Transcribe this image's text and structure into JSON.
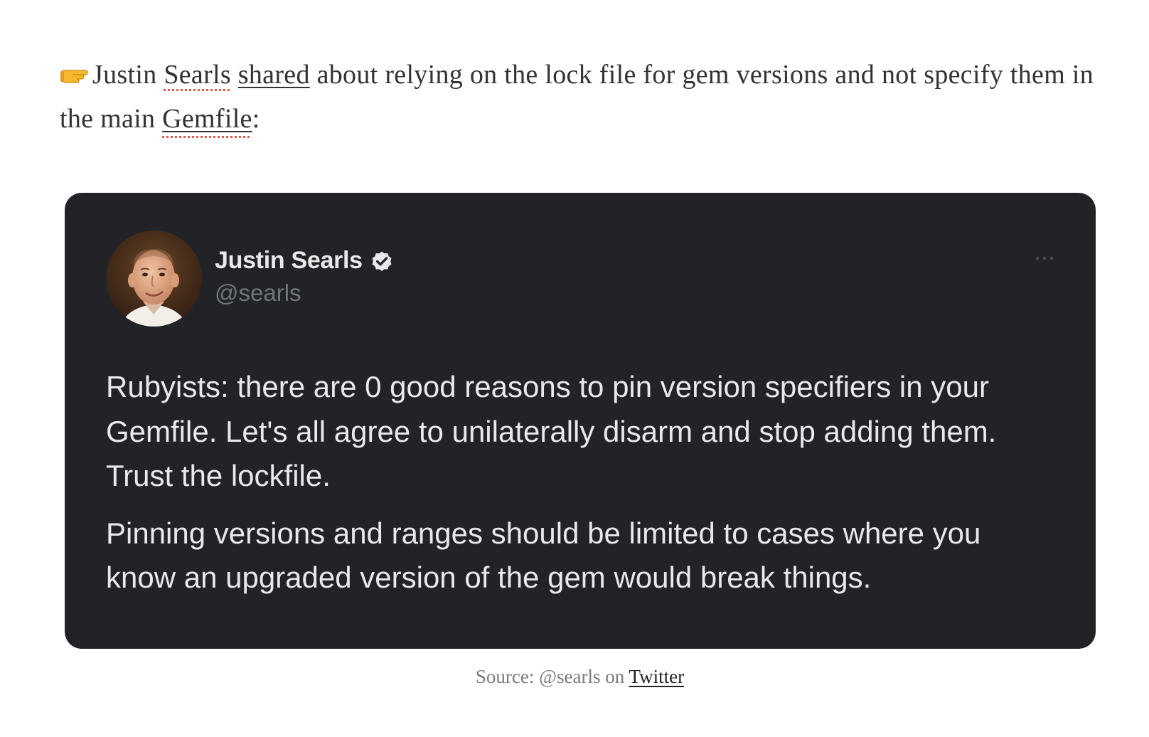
{
  "intro": {
    "name_first": "Justin",
    "name_last": "Searls",
    "link_text": "shared",
    "text_middle": "about relying on the lock file for gem versions and not specify them in the main",
    "gemfile_link": "Gemfile",
    "text_end": ":"
  },
  "tweet": {
    "author_name": "Justin Searls",
    "handle": "@searls",
    "paragraphs": [
      "Rubyists: there are 0 good reasons to pin version specifiers in your Gemfile. Let's all agree to unilaterally disarm and stop adding them. Trust the lockfile.",
      "Pinning versions and ranges should be limited to cases where you know an upgraded version of the gem would break things."
    ]
  },
  "caption": {
    "prefix": "Source: @searls on",
    "link_text": "Twitter"
  },
  "colors": {
    "card_background": "#212327",
    "tweet_text": "#e7e9ea",
    "handle_text": "#71767b",
    "spellcheck_underline": "#e05a4a"
  },
  "icons": [
    "pointing-hand-icon",
    "verified-badge-icon",
    "more-options-icon"
  ]
}
